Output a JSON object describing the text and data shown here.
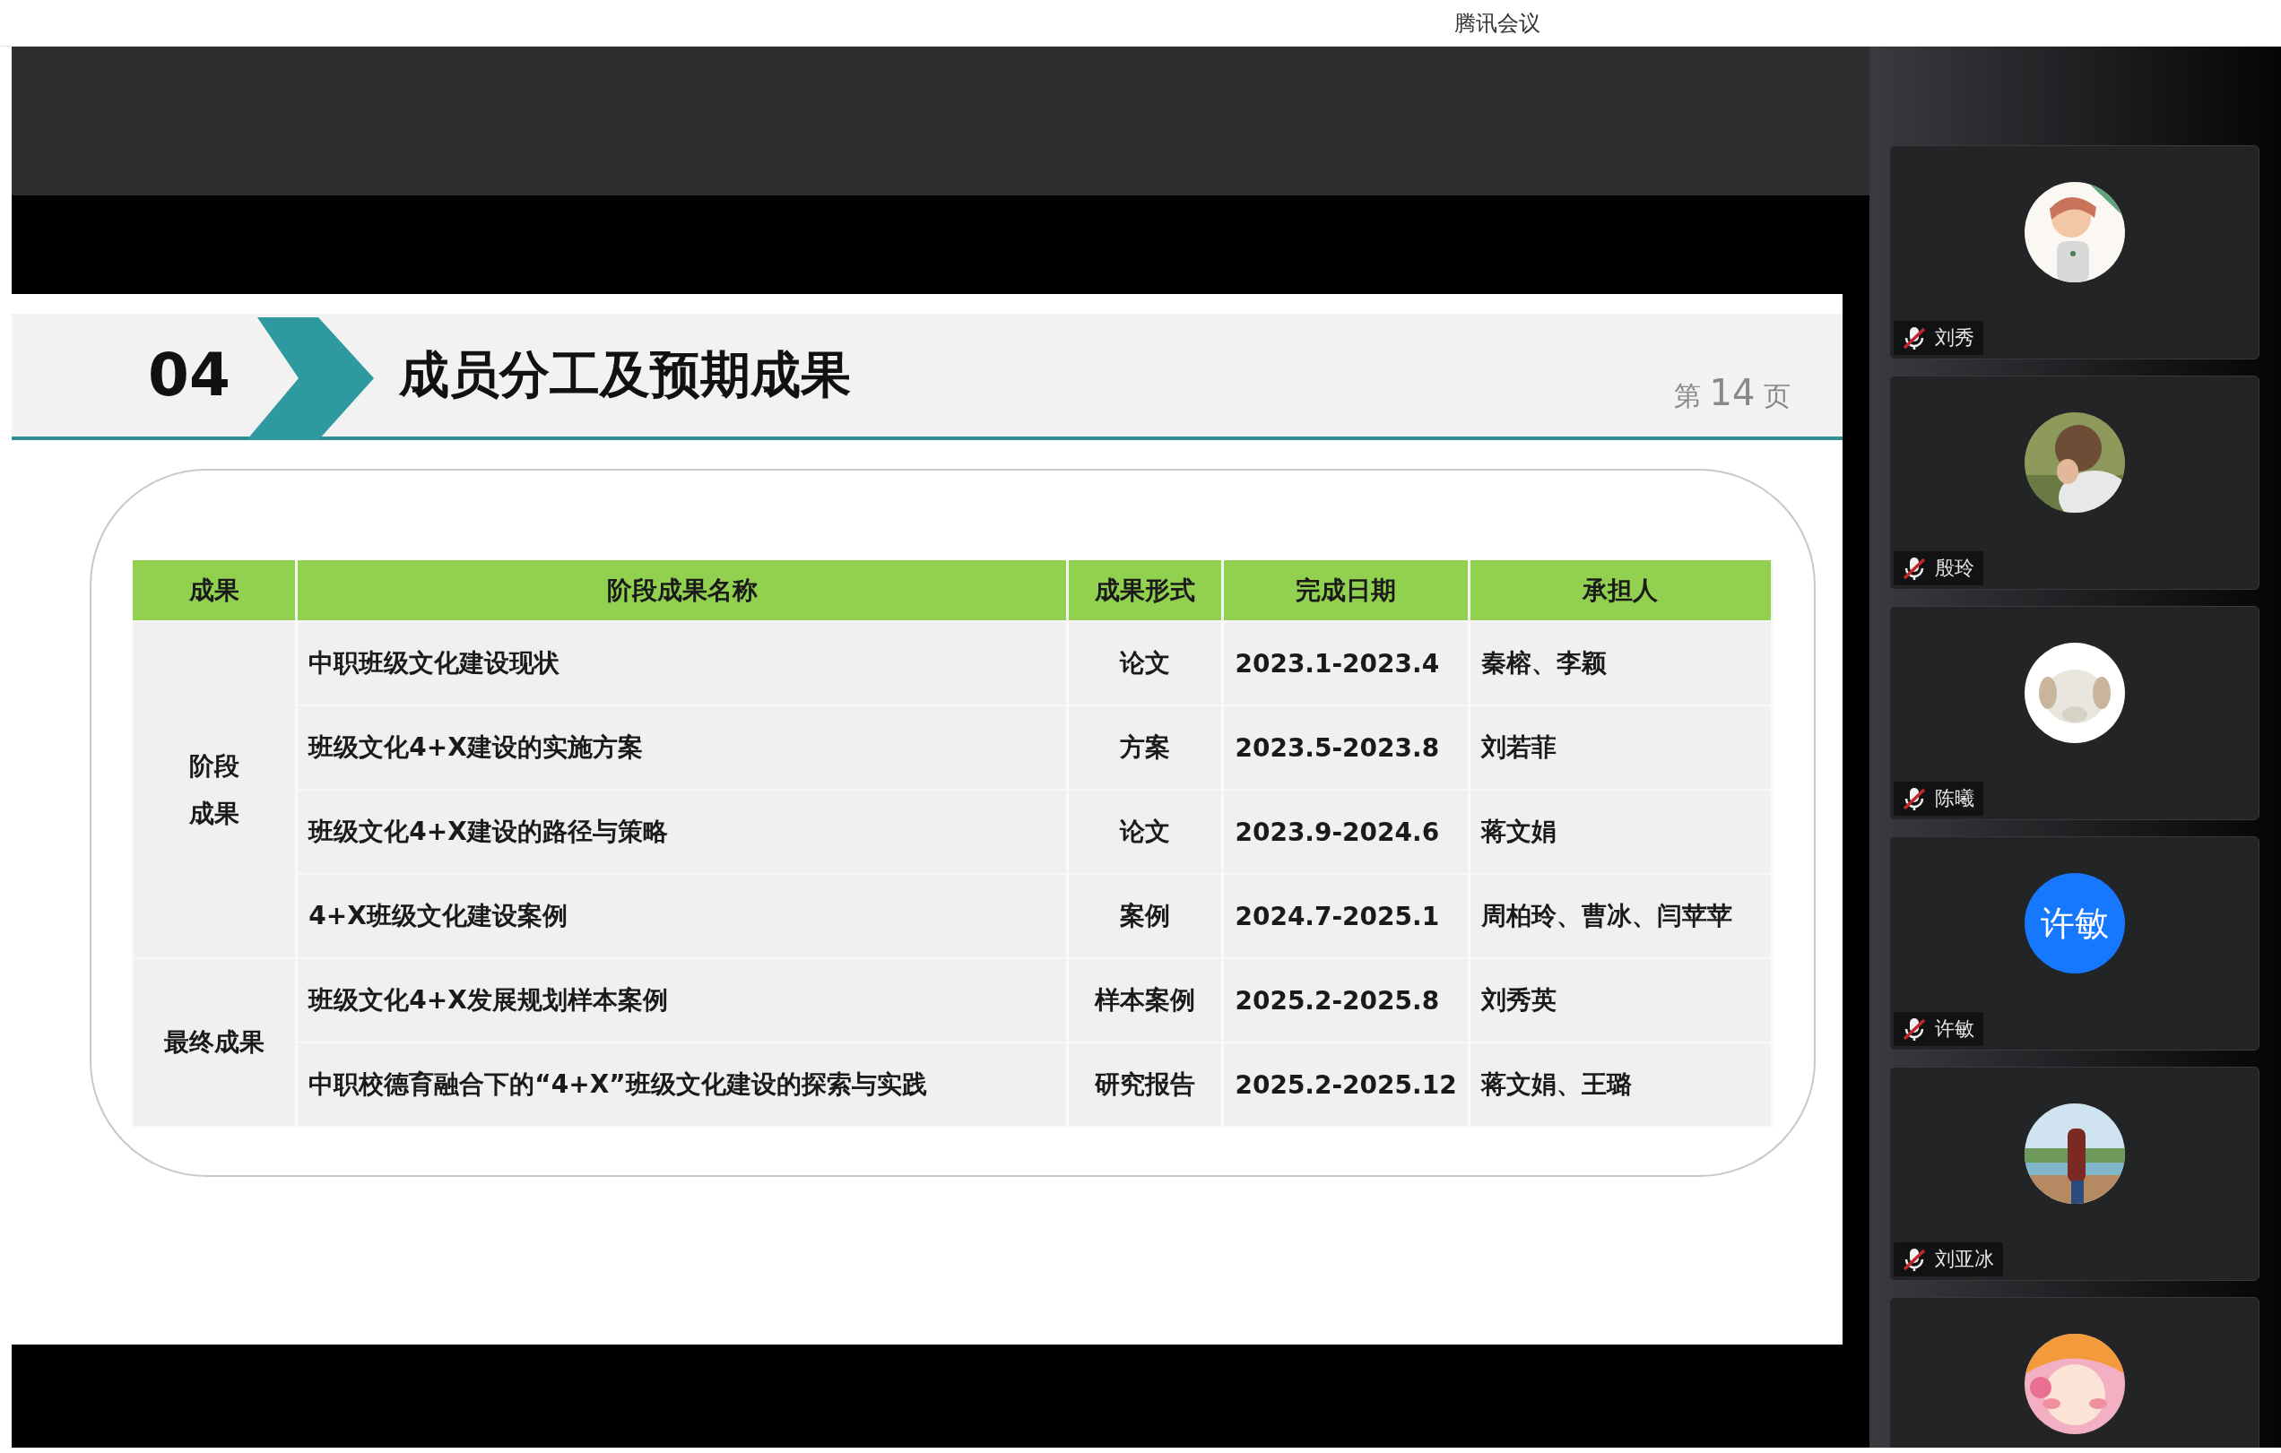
{
  "app": {
    "title": "腾讯会议"
  },
  "slide": {
    "section_number": "04",
    "title": "成员分工及预期成果",
    "page": {
      "prefix": "第",
      "number": "14",
      "suffix": "页"
    },
    "table": {
      "columns": [
        "成果",
        "阶段成果名称",
        "成果形式",
        "完成日期",
        "承担人"
      ],
      "groups": [
        {
          "label": "阶段成果",
          "rows": [
            {
              "name": "中职班级文化建设现状",
              "form": "论文",
              "date": "2023.1-2023.4",
              "owner": "秦榕、李颖"
            },
            {
              "name": "班级文化4+X建设的实施方案",
              "form": "方案",
              "date": "2023.5-2023.8",
              "owner": "刘若菲"
            },
            {
              "name": "班级文化4+X建设的路径与策略",
              "form": "论文",
              "date": "2023.9-2024.6",
              "owner": "蒋文娟"
            },
            {
              "name": "4+X班级文化建设案例",
              "form": "案例",
              "date": "2024.7-2025.1",
              "owner": "周柏玲、曹冰、闫苹苹"
            }
          ]
        },
        {
          "label": "最终成果",
          "rows": [
            {
              "name": "班级文化4+X发展规划样本案例",
              "form": "样本案例",
              "date": "2025.2-2025.8",
              "owner": "刘秀英"
            },
            {
              "name": "中职校德育融合下的“4+X”班级文化建设的探索与实践",
              "form": "研究报告",
              "date": "2025.2-2025.12",
              "owner": "蒋文娟、王璐"
            }
          ]
        }
      ]
    }
  },
  "participants": [
    {
      "name": "刘秀",
      "muted": true,
      "avatar": {
        "kind": "picture"
      }
    },
    {
      "name": "殷玲",
      "muted": true,
      "avatar": {
        "kind": "picture"
      }
    },
    {
      "name": "陈曦",
      "muted": true,
      "avatar": {
        "kind": "picture"
      }
    },
    {
      "name": "许敏",
      "muted": true,
      "avatar": {
        "kind": "text",
        "text": "许敏"
      }
    },
    {
      "name": "刘亚冰",
      "muted": true,
      "avatar": {
        "kind": "picture"
      }
    },
    {
      "avatar": {
        "kind": "picture"
      }
    }
  ]
}
